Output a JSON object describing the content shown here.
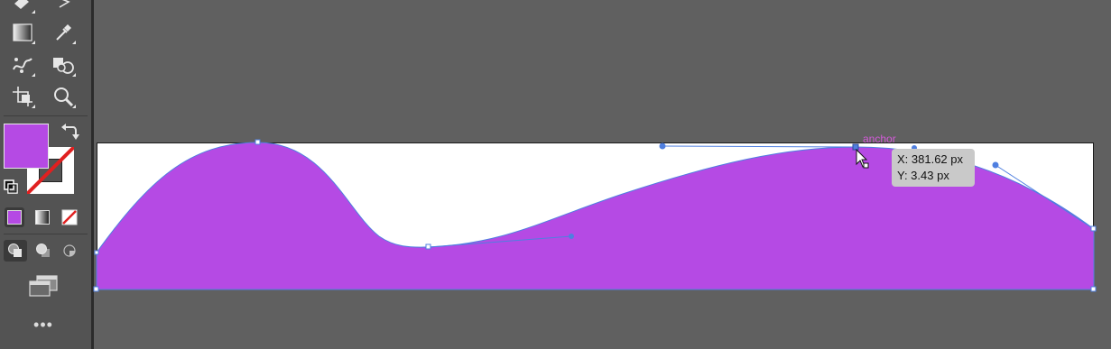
{
  "colors": {
    "fill": "#b54ae4",
    "path_stroke": "#4f7fe0",
    "artboard": "#ffffff",
    "canvas": "#606060",
    "toolbar": "#535353"
  },
  "toolbar": {
    "tools": [
      {
        "name": "eraser-tool",
        "icon": "eraser-icon"
      },
      {
        "name": "free-transform-tool",
        "icon": "free-transform-icon"
      },
      {
        "name": "gradient-tool",
        "icon": "gradient-icon"
      },
      {
        "name": "eyedropper-tool",
        "icon": "eyedropper-icon"
      },
      {
        "name": "puppet-warp-tool",
        "icon": "puppet-warp-icon"
      },
      {
        "name": "shape-builder-tool",
        "icon": "shape-builder-icon"
      },
      {
        "name": "artboard-tool",
        "icon": "artboard-icon"
      },
      {
        "name": "zoom-tool",
        "icon": "zoom-icon"
      }
    ],
    "fill_color": "#b54ae4",
    "stroke": "none",
    "more_label": "•••"
  },
  "canvas": {
    "smart_guide_label": "anchor",
    "tooltip": {
      "x": "X: 381.62 px",
      "y": "Y: 3.43 px"
    }
  }
}
